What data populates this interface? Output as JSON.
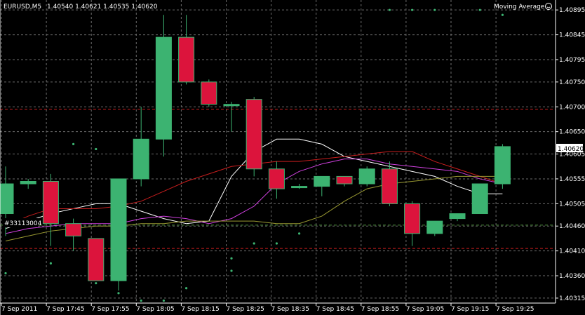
{
  "header": {
    "symbol": "EURUSD,M5",
    "ohlc": "1.40540 1.40621 1.40535 1.40620",
    "indicator": "Moving Average",
    "indicator_icon": "smiley-icon"
  },
  "order_label": "#33113004",
  "current_price": "1.40620",
  "colors": {
    "bull": "#3cb371",
    "bear": "#dc143c",
    "grid": "#6b6b6b",
    "level_red": "#c81e1e",
    "level_green": "#4a8a3a",
    "ma_white": "#ffffff",
    "ma_red": "#c81e1e",
    "ma_magenta": "#d040e0",
    "ma_olive": "#9a9a32"
  },
  "chart_data": {
    "type": "candlestick",
    "title": "EURUSD,M5",
    "ylim": [
      1.40305,
      1.40915
    ],
    "y_ticks": [
      "1.40895",
      "1.40845",
      "1.40795",
      "1.40750",
      "1.40700",
      "1.40650",
      "1.40605",
      "1.40555",
      "1.40505",
      "1.40460",
      "1.40410",
      "1.40360",
      "1.40315"
    ],
    "x_ticks": [
      "7 Sep 2011",
      "7 Sep 17:45",
      "7 Sep 17:55",
      "7 Sep 18:05",
      "7 Sep 18:15",
      "7 Sep 18:25",
      "7 Sep 18:35",
      "7 Sep 18:45",
      "7 Sep 18:55",
      "7 Sep 19:05",
      "7 Sep 19:15",
      "7 Sep 19:25"
    ],
    "candles": [
      {
        "o": 1.40485,
        "h": 1.4058,
        "l": 1.4044,
        "c": 1.40545
      },
      {
        "o": 1.40545,
        "h": 1.40555,
        "l": 1.40535,
        "c": 1.4055
      },
      {
        "o": 1.4055,
        "h": 1.40565,
        "l": 1.4042,
        "c": 1.40465
      },
      {
        "o": 1.40465,
        "h": 1.40475,
        "l": 1.4041,
        "c": 1.4044
      },
      {
        "o": 1.40435,
        "h": 1.40435,
        "l": 1.4035,
        "c": 1.4035
      },
      {
        "o": 1.4035,
        "h": 1.40555,
        "l": 1.4033,
        "c": 1.40555
      },
      {
        "o": 1.40555,
        "h": 1.407,
        "l": 1.4054,
        "c": 1.40635
      },
      {
        "o": 1.40635,
        "h": 1.40885,
        "l": 1.406,
        "c": 1.4084
      },
      {
        "o": 1.4084,
        "h": 1.40885,
        "l": 1.40745,
        "c": 1.4075
      },
      {
        "o": 1.4075,
        "h": 1.40755,
        "l": 1.407,
        "c": 1.40705
      },
      {
        "o": 1.40705,
        "h": 1.4071,
        "l": 1.4065,
        "c": 1.40705
      },
      {
        "o": 1.40715,
        "h": 1.4072,
        "l": 1.4056,
        "c": 1.40575
      },
      {
        "o": 1.40575,
        "h": 1.4059,
        "l": 1.40515,
        "c": 1.40535
      },
      {
        "o": 1.4054,
        "h": 1.40545,
        "l": 1.40535,
        "c": 1.4054
      },
      {
        "o": 1.4054,
        "h": 1.4056,
        "l": 1.4052,
        "c": 1.4056
      },
      {
        "o": 1.4056,
        "h": 1.4056,
        "l": 1.4054,
        "c": 1.40545
      },
      {
        "o": 1.40545,
        "h": 1.4058,
        "l": 1.4054,
        "c": 1.40575
      },
      {
        "o": 1.40575,
        "h": 1.4059,
        "l": 1.405,
        "c": 1.40505
      },
      {
        "o": 1.40505,
        "h": 1.4051,
        "l": 1.4042,
        "c": 1.40445
      },
      {
        "o": 1.40445,
        "h": 1.4047,
        "l": 1.4044,
        "c": 1.4047
      },
      {
        "o": 1.40475,
        "h": 1.40485,
        "l": 1.4047,
        "c": 1.40485
      },
      {
        "o": 1.40485,
        "h": 1.4054,
        "l": 1.40485,
        "c": 1.40545
      },
      {
        "o": 1.40545,
        "h": 1.40625,
        "l": 1.40535,
        "c": 1.4062
      }
    ],
    "moving_averages": [
      {
        "color": "#ffffff",
        "values": [
          1.40455,
          1.4047,
          1.40485,
          1.40495,
          1.40505,
          1.40505,
          1.4049,
          1.40475,
          1.40465,
          1.4047,
          1.4056,
          1.4061,
          1.40635,
          1.40635,
          1.40625,
          1.406,
          1.4059,
          1.4058,
          1.4057,
          1.4056,
          1.4054,
          1.40525,
          1.40525
        ]
      },
      {
        "color": "#c81e1e",
        "values": [
          1.4046,
          1.4048,
          1.40495,
          1.40495,
          1.40495,
          1.405,
          1.4051,
          1.4053,
          1.4055,
          1.40565,
          1.4058,
          1.40585,
          1.4059,
          1.4059,
          1.40595,
          1.406,
          1.40605,
          1.4061,
          1.4061,
          1.4059,
          1.40575,
          1.4056,
          1.40545
        ]
      },
      {
        "color": "#d040e0",
        "values": [
          1.40445,
          1.40455,
          1.4046,
          1.40465,
          1.40465,
          1.40465,
          1.40475,
          1.4048,
          1.40475,
          1.40465,
          1.40475,
          1.405,
          1.40545,
          1.4057,
          1.40585,
          1.40595,
          1.40595,
          1.40585,
          1.4058,
          1.40575,
          1.4057,
          1.40555,
          1.40545
        ]
      },
      {
        "color": "#9a9a32",
        "values": [
          1.4043,
          1.4044,
          1.4045,
          1.40455,
          1.4046,
          1.4046,
          1.40465,
          1.40465,
          1.4047,
          1.4047,
          1.4047,
          1.4047,
          1.40465,
          1.40465,
          1.4048,
          1.4051,
          1.40535,
          1.40545,
          1.4055,
          1.40555,
          1.4056,
          1.4056,
          1.4056
        ]
      }
    ],
    "fractal_dots": [
      {
        "i": 0,
        "v": 1.40365
      },
      {
        "i": 2,
        "v": 1.40385
      },
      {
        "i": 4,
        "v": 1.40345
      },
      {
        "i": 5,
        "v": 1.40325
      },
      {
        "i": 6,
        "v": 1.4031
      },
      {
        "i": 6,
        "v": 1.40615
      },
      {
        "i": 7,
        "v": 1.4031
      },
      {
        "i": 8,
        "v": 1.40335
      },
      {
        "i": 10,
        "v": 1.4037
      },
      {
        "i": 10,
        "v": 1.40395
      },
      {
        "i": 11,
        "v": 1.40425
      },
      {
        "i": 12,
        "v": 1.40425
      },
      {
        "i": 13,
        "v": 1.40445
      },
      {
        "i": 17,
        "v": 1.40895
      },
      {
        "i": 18,
        "v": 1.40895
      },
      {
        "i": 19,
        "v": 1.40895
      },
      {
        "i": 21,
        "v": 1.40895
      },
      {
        "i": 22,
        "v": 1.40885
      },
      {
        "i": 4,
        "v": 1.40615
      },
      {
        "i": 3,
        "v": 1.40625
      }
    ],
    "levels": [
      {
        "value": 1.40695,
        "color": "#c81e1e"
      },
      {
        "value": 1.40415,
        "color": "#c81e1e"
      },
      {
        "value": 1.40462,
        "color": "#4a8a3a"
      }
    ]
  }
}
